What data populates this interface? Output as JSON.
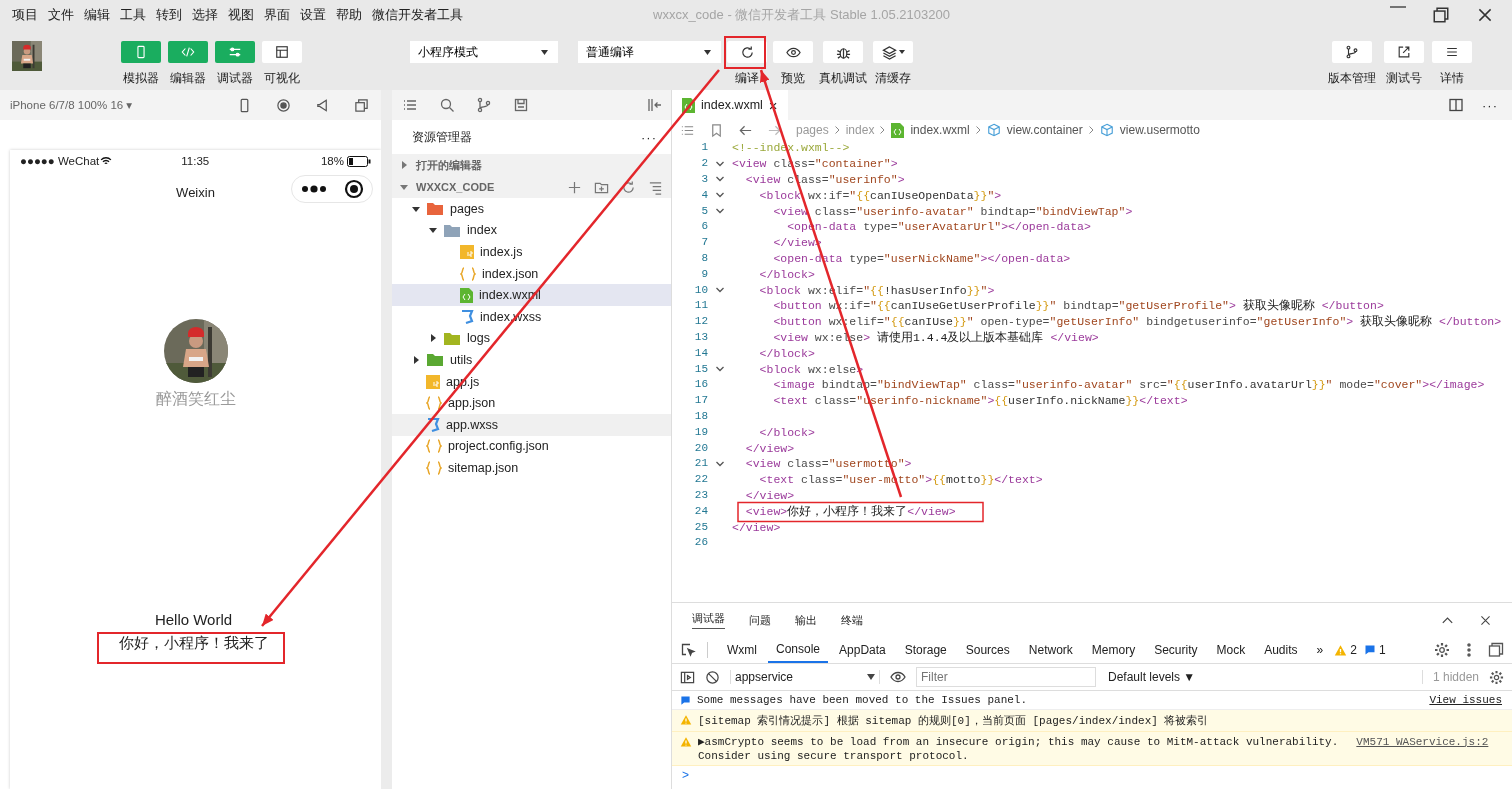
{
  "menu_bar": {
    "items": [
      "项目",
      "文件",
      "编辑",
      "工具",
      "转到",
      "选择",
      "视图",
      "界面",
      "设置",
      "帮助",
      "微信开发者工具"
    ],
    "title": "wxxcx_code - 微信开发者工具 Stable 1.05.2103200"
  },
  "toolbar": {
    "modes": [
      {
        "label": "模拟器",
        "on": true
      },
      {
        "label": "编辑器",
        "on": true
      },
      {
        "label": "调试器",
        "on": true
      },
      {
        "label": "可视化",
        "on": false
      }
    ],
    "dropdowns": [
      "小程序模式",
      "普通编译"
    ],
    "actions": [
      {
        "label": "编译"
      },
      {
        "label": "预览"
      },
      {
        "label": "真机调试"
      },
      {
        "label": "清缓存"
      }
    ],
    "right_actions": [
      {
        "label": "版本管理"
      },
      {
        "label": "测试号"
      },
      {
        "label": "详情"
      }
    ]
  },
  "simulator": {
    "device": "iPhone 6/7/8 100% 16 ▾",
    "carrier": "●●●●● WeChat",
    "time": "11:35",
    "battery": "18%",
    "nav_title": "Weixin",
    "nickname": "醉酒笑红尘",
    "lines": [
      "Hello World",
      "你好，小程序！我来了"
    ]
  },
  "explorer": {
    "title": "资源管理器",
    "more": "···",
    "sections": [
      {
        "label": "打开的编辑器",
        "expanded": false
      },
      {
        "label": "WXXCX_CODE",
        "expanded": true
      }
    ],
    "tree": [
      {
        "name": "pages",
        "kind": "folder",
        "color": "#e8643c",
        "expanded": true,
        "selected": false,
        "hovered": false,
        "children": [
          {
            "name": "index",
            "kind": "folder",
            "color": "#8fa3b8",
            "expanded": true,
            "selected": false,
            "hovered": false,
            "children": [
              {
                "name": "index.js",
                "kind": "js",
                "selected": false,
                "hovered": false
              },
              {
                "name": "index.json",
                "kind": "json",
                "selected": false,
                "hovered": false
              },
              {
                "name": "index.wxml",
                "kind": "wxml",
                "selected": true,
                "hovered": false
              },
              {
                "name": "index.wxss",
                "kind": "wxss",
                "selected": false,
                "hovered": false
              }
            ]
          },
          {
            "name": "logs",
            "kind": "folder",
            "color": "#a2b520",
            "expanded": false,
            "selected": false,
            "hovered": false
          }
        ]
      },
      {
        "name": "utils",
        "kind": "folder",
        "color": "#5aa832",
        "expanded": false,
        "selected": false,
        "hovered": false
      },
      {
        "name": "app.js",
        "kind": "js",
        "selected": false,
        "hovered": false
      },
      {
        "name": "app.json",
        "kind": "json",
        "selected": false,
        "hovered": false
      },
      {
        "name": "app.wxss",
        "kind": "wxss",
        "selected": false,
        "hovered": true
      },
      {
        "name": "project.config.json",
        "kind": "json",
        "selected": false,
        "hovered": false
      },
      {
        "name": "sitemap.json",
        "kind": "json",
        "selected": false,
        "hovered": false
      }
    ]
  },
  "editor": {
    "tab": {
      "label": "index.wxml",
      "close": "×"
    },
    "more": "···",
    "breadcrumb": [
      "pages",
      "index",
      "index.wxml",
      "view.container",
      "view.usermotto"
    ],
    "lines": [
      {
        "n": "1",
        "fold": false,
        "tokens": [
          {
            "kind": "comment",
            "text": "<!--index.wxml-->"
          }
        ]
      },
      {
        "n": "2",
        "fold": true,
        "tokens": [
          {
            "kind": "tag",
            "text": "<view"
          },
          {
            "kind": "attr",
            "text": " class="
          },
          {
            "kind": "string",
            "text": "\"container\""
          },
          {
            "kind": "tag",
            "text": ">"
          }
        ]
      },
      {
        "n": "3",
        "fold": true,
        "tokens": [
          {
            "kind": "tag",
            "text": "  <view"
          },
          {
            "kind": "attr",
            "text": " class="
          },
          {
            "kind": "string",
            "text": "\"userinfo\""
          },
          {
            "kind": "tag",
            "text": ">"
          }
        ]
      },
      {
        "n": "4",
        "fold": true,
        "tokens": [
          {
            "kind": "tag",
            "text": "    <block"
          },
          {
            "kind": "attr",
            "text": " wx:if="
          },
          {
            "kind": "string",
            "text": "\""
          },
          {
            "kind": "brace",
            "text": "{{"
          },
          {
            "kind": "var",
            "text": "canIUseOpenData"
          },
          {
            "kind": "brace",
            "text": "}}"
          },
          {
            "kind": "string",
            "text": "\""
          },
          {
            "kind": "tag",
            "text": ">"
          }
        ]
      },
      {
        "n": "5",
        "fold": true,
        "tokens": [
          {
            "kind": "tag",
            "text": "      <view"
          },
          {
            "kind": "attr",
            "text": " class="
          },
          {
            "kind": "string",
            "text": "\"userinfo-avatar\""
          },
          {
            "kind": "attr",
            "text": " bindtap="
          },
          {
            "kind": "string",
            "text": "\"bindViewTap\""
          },
          {
            "kind": "tag",
            "text": ">"
          }
        ]
      },
      {
        "n": "6",
        "fold": false,
        "tokens": [
          {
            "kind": "tag",
            "text": "        <open-data"
          },
          {
            "kind": "attr",
            "text": " type="
          },
          {
            "kind": "string",
            "text": "\"userAvatarUrl\""
          },
          {
            "kind": "tag",
            "text": "></open-data>"
          }
        ]
      },
      {
        "n": "7",
        "fold": false,
        "tokens": [
          {
            "kind": "tag",
            "text": "      </view>"
          }
        ]
      },
      {
        "n": "8",
        "fold": false,
        "tokens": [
          {
            "kind": "tag",
            "text": "      <open-data"
          },
          {
            "kind": "attr",
            "text": " type="
          },
          {
            "kind": "string",
            "text": "\"userNickName\""
          },
          {
            "kind": "tag",
            "text": "></open-data>"
          }
        ]
      },
      {
        "n": "9",
        "fold": false,
        "tokens": [
          {
            "kind": "tag",
            "text": "    </block>"
          }
        ]
      },
      {
        "n": "10",
        "fold": true,
        "tokens": [
          {
            "kind": "tag",
            "text": "    <block"
          },
          {
            "kind": "attr",
            "text": " wx:elif="
          },
          {
            "kind": "string",
            "text": "\""
          },
          {
            "kind": "brace",
            "text": "{{"
          },
          {
            "kind": "var",
            "text": "!hasUserInfo"
          },
          {
            "kind": "brace",
            "text": "}}"
          },
          {
            "kind": "string",
            "text": "\""
          },
          {
            "kind": "tag",
            "text": ">"
          }
        ]
      },
      {
        "n": "11",
        "fold": false,
        "tokens": [
          {
            "kind": "tag",
            "text": "      <button"
          },
          {
            "kind": "attr",
            "text": " wx:if="
          },
          {
            "kind": "string",
            "text": "\""
          },
          {
            "kind": "brace",
            "text": "{{"
          },
          {
            "kind": "var",
            "text": "canIUseGetUserProfile"
          },
          {
            "kind": "brace",
            "text": "}}"
          },
          {
            "kind": "string",
            "text": "\""
          },
          {
            "kind": "attr",
            "text": " bindtap="
          },
          {
            "kind": "string",
            "text": "\"getUserProfile\""
          },
          {
            "kind": "tag",
            "text": ">"
          },
          {
            "kind": "text",
            "text": " 获取头像昵称 "
          },
          {
            "kind": "tag",
            "text": "</button>"
          }
        ]
      },
      {
        "n": "12",
        "fold": false,
        "tokens": [
          {
            "kind": "tag",
            "text": "      <button"
          },
          {
            "kind": "attr",
            "text": " wx:elif="
          },
          {
            "kind": "string",
            "text": "\""
          },
          {
            "kind": "brace",
            "text": "{{"
          },
          {
            "kind": "var",
            "text": "canIUse"
          },
          {
            "kind": "brace",
            "text": "}}"
          },
          {
            "kind": "string",
            "text": "\""
          },
          {
            "kind": "attr",
            "text": " open-type="
          },
          {
            "kind": "string",
            "text": "\"getUserInfo\""
          },
          {
            "kind": "attr",
            "text": " bindgetuserinfo="
          },
          {
            "kind": "string",
            "text": "\"getUserInfo\""
          },
          {
            "kind": "tag",
            "text": ">"
          },
          {
            "kind": "text",
            "text": " 获取头像昵称 "
          },
          {
            "kind": "tag",
            "text": "</button>"
          }
        ]
      },
      {
        "n": "13",
        "fold": false,
        "tokens": [
          {
            "kind": "tag",
            "text": "      <view"
          },
          {
            "kind": "attr",
            "text": " wx:else"
          },
          {
            "kind": "tag",
            "text": ">"
          },
          {
            "kind": "text",
            "text": " 请使用1.4.4及以上版本基础库 "
          },
          {
            "kind": "tag",
            "text": "</view>"
          }
        ]
      },
      {
        "n": "14",
        "fold": false,
        "tokens": [
          {
            "kind": "tag",
            "text": "    </block>"
          }
        ]
      },
      {
        "n": "15",
        "fold": true,
        "tokens": [
          {
            "kind": "tag",
            "text": "    <block"
          },
          {
            "kind": "attr",
            "text": " wx:else"
          },
          {
            "kind": "tag",
            "text": ">"
          }
        ]
      },
      {
        "n": "16",
        "fold": false,
        "tokens": [
          {
            "kind": "tag",
            "text": "      <image"
          },
          {
            "kind": "attr",
            "text": " bindtap="
          },
          {
            "kind": "string",
            "text": "\"bindViewTap\""
          },
          {
            "kind": "attr",
            "text": " class="
          },
          {
            "kind": "string",
            "text": "\"userinfo-avatar\""
          },
          {
            "kind": "attr",
            "text": " src="
          },
          {
            "kind": "string",
            "text": "\""
          },
          {
            "kind": "brace",
            "text": "{{"
          },
          {
            "kind": "var",
            "text": "userInfo.avatarUrl"
          },
          {
            "kind": "brace",
            "text": "}}"
          },
          {
            "kind": "string",
            "text": "\""
          },
          {
            "kind": "attr",
            "text": " mode="
          },
          {
            "kind": "string",
            "text": "\"cover\""
          },
          {
            "kind": "tag",
            "text": "></image>"
          }
        ]
      },
      {
        "n": "17",
        "fold": false,
        "tokens": [
          {
            "kind": "tag",
            "text": "      <text"
          },
          {
            "kind": "attr",
            "text": " class="
          },
          {
            "kind": "string",
            "text": "\"userinfo-nickname\""
          },
          {
            "kind": "tag",
            "text": ">"
          },
          {
            "kind": "brace",
            "text": "{{"
          },
          {
            "kind": "var",
            "text": "userInfo.nickName"
          },
          {
            "kind": "brace",
            "text": "}}"
          },
          {
            "kind": "tag",
            "text": "</text>"
          }
        ]
      },
      {
        "n": "18",
        "fold": false
      },
      {
        "n": "19",
        "fold": false,
        "tokens": [
          {
            "kind": "tag",
            "text": "    </block>"
          }
        ]
      },
      {
        "n": "20",
        "fold": false,
        "tokens": [
          {
            "kind": "tag",
            "text": "  </view>"
          }
        ]
      },
      {
        "n": "21",
        "fold": true,
        "tokens": [
          {
            "kind": "tag",
            "text": "  <view"
          },
          {
            "kind": "attr",
            "text": " class="
          },
          {
            "kind": "string",
            "text": "\"usermotto\""
          },
          {
            "kind": "tag",
            "text": ">"
          }
        ]
      },
      {
        "n": "22",
        "fold": false,
        "tokens": [
          {
            "kind": "tag",
            "text": "    <text"
          },
          {
            "kind": "attr",
            "text": " class="
          },
          {
            "kind": "string",
            "text": "\"user-motto\""
          },
          {
            "kind": "tag",
            "text": ">"
          },
          {
            "kind": "brace",
            "text": "{{"
          },
          {
            "kind": "var",
            "text": "motto"
          },
          {
            "kind": "brace",
            "text": "}}"
          },
          {
            "kind": "tag",
            "text": "</text>"
          }
        ]
      },
      {
        "n": "23",
        "fold": false,
        "tokens": [
          {
            "kind": "tag",
            "text": "  </view>"
          }
        ]
      },
      {
        "n": "24",
        "fold": false,
        "tokens": [
          {
            "kind": "tag",
            "text": "  <view>"
          },
          {
            "kind": "text",
            "text": "你好，小程序！我来了"
          },
          {
            "kind": "tag",
            "text": "</view>"
          }
        ]
      },
      {
        "n": "25",
        "fold": false,
        "tokens": [
          {
            "kind": "tag",
            "text": "</view>"
          }
        ]
      },
      {
        "n": "26",
        "fold": false
      }
    ]
  },
  "devtools": {
    "panel_tabs": [
      {
        "label": "调试器",
        "selected": true
      },
      {
        "label": "问题",
        "selected": false
      },
      {
        "label": "输出",
        "selected": false
      },
      {
        "label": "终端",
        "selected": false
      }
    ],
    "tabs": [
      {
        "label": "Wxml",
        "selected": false
      },
      {
        "label": "Console",
        "selected": true
      },
      {
        "label": "AppData",
        "selected": false
      },
      {
        "label": "Storage",
        "selected": false
      },
      {
        "label": "Sources",
        "selected": false
      },
      {
        "label": "Network",
        "selected": false
      },
      {
        "label": "Memory",
        "selected": false
      },
      {
        "label": "Security",
        "selected": false
      },
      {
        "label": "Mock",
        "selected": false
      },
      {
        "label": "Audits",
        "selected": false
      }
    ],
    "more_tabs": "»",
    "warnings": "2",
    "infos": "1",
    "context": "appservice",
    "filter": {
      "placeholder": "Filter"
    },
    "levels": "Default levels ▼",
    "hidden": "1 hidden",
    "messages": [
      {
        "kind": "info",
        "text": "Some messages have been moved to the Issues panel.",
        "link": "View issues"
      },
      {
        "kind": "warning",
        "text": "[sitemap 索引情况提示] 根据 sitemap 的规则[0]，当前页面 [pages/index/index] 将被索引"
      },
      {
        "kind": "warning",
        "text": "▶asmCrypto seems to be load from an insecure origin; this may cause to MitM-attack vulnerability.",
        "text2": "Consider using secure transport protocol.",
        "source": "VM571 WAService.js:2"
      }
    ],
    "prompt": ">"
  }
}
